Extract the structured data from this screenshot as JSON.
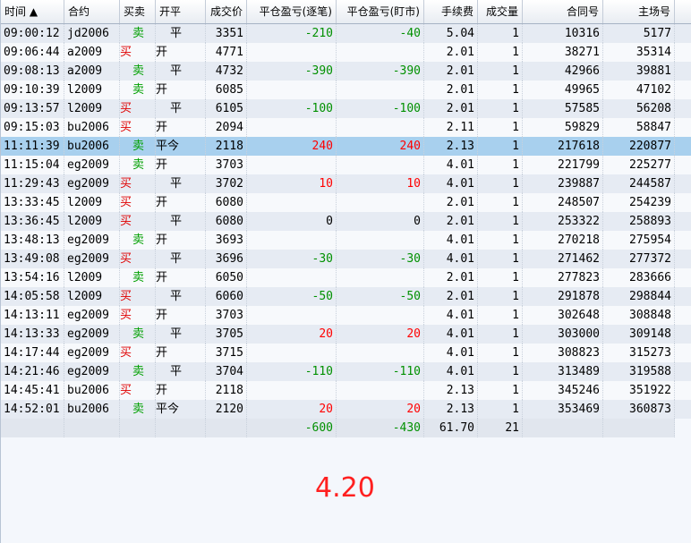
{
  "headers": [
    "时间 ▲",
    "合约",
    "买卖",
    "开平",
    "成交价",
    "平仓盈亏(逐笔)",
    "平仓盈亏(盯市)",
    "手续费",
    "成交量",
    "合同号",
    "主场号"
  ],
  "rows": [
    {
      "time": "09:00:12",
      "contract": "jd2006",
      "bs": "卖",
      "bs_type": "sell",
      "oc": "平",
      "oc_type": "close",
      "price": "3351",
      "pnl1": "-210",
      "pnl1_type": "neg",
      "pnl2": "-40",
      "pnl2_type": "neg",
      "fee": "5.04",
      "qty": "1",
      "order": "10316",
      "match": "5177",
      "style": "alt"
    },
    {
      "time": "09:06:44",
      "contract": "a2009",
      "bs": "买",
      "bs_type": "buy",
      "oc": "开",
      "oc_type": "open",
      "price": "4771",
      "pnl1": "",
      "pnl1_type": "zero",
      "pnl2": "",
      "pnl2_type": "zero",
      "fee": "2.01",
      "qty": "1",
      "order": "38271",
      "match": "35314",
      "style": "plain"
    },
    {
      "time": "09:08:13",
      "contract": "a2009",
      "bs": "卖",
      "bs_type": "sell",
      "oc": "平",
      "oc_type": "close",
      "price": "4732",
      "pnl1": "-390",
      "pnl1_type": "neg",
      "pnl2": "-390",
      "pnl2_type": "neg",
      "fee": "2.01",
      "qty": "1",
      "order": "42966",
      "match": "39881",
      "style": "alt"
    },
    {
      "time": "09:10:39",
      "contract": "l2009",
      "bs": "卖",
      "bs_type": "sell",
      "oc": "开",
      "oc_type": "open",
      "price": "6085",
      "pnl1": "",
      "pnl1_type": "zero",
      "pnl2": "",
      "pnl2_type": "zero",
      "fee": "2.01",
      "qty": "1",
      "order": "49965",
      "match": "47102",
      "style": "plain"
    },
    {
      "time": "09:13:57",
      "contract": "l2009",
      "bs": "买",
      "bs_type": "buy",
      "oc": "平",
      "oc_type": "close",
      "price": "6105",
      "pnl1": "-100",
      "pnl1_type": "neg",
      "pnl2": "-100",
      "pnl2_type": "neg",
      "fee": "2.01",
      "qty": "1",
      "order": "57585",
      "match": "56208",
      "style": "alt"
    },
    {
      "time": "09:15:03",
      "contract": "bu2006",
      "bs": "买",
      "bs_type": "buy",
      "oc": "开",
      "oc_type": "open",
      "price": "2094",
      "pnl1": "",
      "pnl1_type": "zero",
      "pnl2": "",
      "pnl2_type": "zero",
      "fee": "2.11",
      "qty": "1",
      "order": "59829",
      "match": "58847",
      "style": "plain"
    },
    {
      "time": "11:11:39",
      "contract": "bu2006",
      "bs": "卖",
      "bs_type": "sell",
      "oc": "平今",
      "oc_type": "open",
      "price": "2118",
      "pnl1": "240",
      "pnl1_type": "pos",
      "pnl2": "240",
      "pnl2_type": "pos",
      "fee": "2.13",
      "qty": "1",
      "order": "217618",
      "match": "220877",
      "style": "selected"
    },
    {
      "time": "11:15:04",
      "contract": "eg2009",
      "bs": "卖",
      "bs_type": "sell",
      "oc": "开",
      "oc_type": "open",
      "price": "3703",
      "pnl1": "",
      "pnl1_type": "zero",
      "pnl2": "",
      "pnl2_type": "zero",
      "fee": "4.01",
      "qty": "1",
      "order": "221799",
      "match": "225277",
      "style": "plain"
    },
    {
      "time": "11:29:43",
      "contract": "eg2009",
      "bs": "买",
      "bs_type": "buy",
      "oc": "平",
      "oc_type": "close",
      "price": "3702",
      "pnl1": "10",
      "pnl1_type": "pos",
      "pnl2": "10",
      "pnl2_type": "pos",
      "fee": "4.01",
      "qty": "1",
      "order": "239887",
      "match": "244587",
      "style": "alt"
    },
    {
      "time": "13:33:45",
      "contract": "l2009",
      "bs": "买",
      "bs_type": "buy",
      "oc": "开",
      "oc_type": "open",
      "price": "6080",
      "pnl1": "",
      "pnl1_type": "zero",
      "pnl2": "",
      "pnl2_type": "zero",
      "fee": "2.01",
      "qty": "1",
      "order": "248507",
      "match": "254239",
      "style": "plain"
    },
    {
      "time": "13:36:45",
      "contract": "l2009",
      "bs": "买",
      "bs_type": "buy",
      "oc": "平",
      "oc_type": "close",
      "price": "6080",
      "pnl1": "0",
      "pnl1_type": "zero",
      "pnl2": "0",
      "pnl2_type": "zero",
      "fee": "2.01",
      "qty": "1",
      "order": "253322",
      "match": "258893",
      "style": "alt"
    },
    {
      "time": "13:48:13",
      "contract": "eg2009",
      "bs": "卖",
      "bs_type": "sell",
      "oc": "开",
      "oc_type": "open",
      "price": "3693",
      "pnl1": "",
      "pnl1_type": "zero",
      "pnl2": "",
      "pnl2_type": "zero",
      "fee": "4.01",
      "qty": "1",
      "order": "270218",
      "match": "275954",
      "style": "plain"
    },
    {
      "time": "13:49:08",
      "contract": "eg2009",
      "bs": "买",
      "bs_type": "buy",
      "oc": "平",
      "oc_type": "close",
      "price": "3696",
      "pnl1": "-30",
      "pnl1_type": "neg",
      "pnl2": "-30",
      "pnl2_type": "neg",
      "fee": "4.01",
      "qty": "1",
      "order": "271462",
      "match": "277372",
      "style": "alt"
    },
    {
      "time": "13:54:16",
      "contract": "l2009",
      "bs": "卖",
      "bs_type": "sell",
      "oc": "开",
      "oc_type": "open",
      "price": "6050",
      "pnl1": "",
      "pnl1_type": "zero",
      "pnl2": "",
      "pnl2_type": "zero",
      "fee": "2.01",
      "qty": "1",
      "order": "277823",
      "match": "283666",
      "style": "plain"
    },
    {
      "time": "14:05:58",
      "contract": "l2009",
      "bs": "买",
      "bs_type": "buy",
      "oc": "平",
      "oc_type": "close",
      "price": "6060",
      "pnl1": "-50",
      "pnl1_type": "neg",
      "pnl2": "-50",
      "pnl2_type": "neg",
      "fee": "2.01",
      "qty": "1",
      "order": "291878",
      "match": "298844",
      "style": "alt"
    },
    {
      "time": "14:13:11",
      "contract": "eg2009",
      "bs": "买",
      "bs_type": "buy",
      "oc": "开",
      "oc_type": "open",
      "price": "3703",
      "pnl1": "",
      "pnl1_type": "zero",
      "pnl2": "",
      "pnl2_type": "zero",
      "fee": "4.01",
      "qty": "1",
      "order": "302648",
      "match": "308848",
      "style": "plain"
    },
    {
      "time": "14:13:33",
      "contract": "eg2009",
      "bs": "卖",
      "bs_type": "sell",
      "oc": "平",
      "oc_type": "close",
      "price": "3705",
      "pnl1": "20",
      "pnl1_type": "pos",
      "pnl2": "20",
      "pnl2_type": "pos",
      "fee": "4.01",
      "qty": "1",
      "order": "303000",
      "match": "309148",
      "style": "alt"
    },
    {
      "time": "14:17:44",
      "contract": "eg2009",
      "bs": "买",
      "bs_type": "buy",
      "oc": "开",
      "oc_type": "open",
      "price": "3715",
      "pnl1": "",
      "pnl1_type": "zero",
      "pnl2": "",
      "pnl2_type": "zero",
      "fee": "4.01",
      "qty": "1",
      "order": "308823",
      "match": "315273",
      "style": "plain"
    },
    {
      "time": "14:21:46",
      "contract": "eg2009",
      "bs": "卖",
      "bs_type": "sell",
      "oc": "平",
      "oc_type": "close",
      "price": "3704",
      "pnl1": "-110",
      "pnl1_type": "neg",
      "pnl2": "-110",
      "pnl2_type": "neg",
      "fee": "4.01",
      "qty": "1",
      "order": "313489",
      "match": "319588",
      "style": "alt"
    },
    {
      "time": "14:45:41",
      "contract": "bu2006",
      "bs": "买",
      "bs_type": "buy",
      "oc": "开",
      "oc_type": "open",
      "price": "2118",
      "pnl1": "",
      "pnl1_type": "zero",
      "pnl2": "",
      "pnl2_type": "zero",
      "fee": "2.13",
      "qty": "1",
      "order": "345246",
      "match": "351922",
      "style": "plain"
    },
    {
      "time": "14:52:01",
      "contract": "bu2006",
      "bs": "卖",
      "bs_type": "sell",
      "oc": "平今",
      "oc_type": "open",
      "price": "2120",
      "pnl1": "20",
      "pnl1_type": "pos",
      "pnl2": "20",
      "pnl2_type": "pos",
      "fee": "2.13",
      "qty": "1",
      "order": "353469",
      "match": "360873",
      "style": "alt"
    }
  ],
  "totals": {
    "pnl1": "-600",
    "pnl2": "-430",
    "fee": "61.70",
    "qty": "21"
  },
  "overlay_value": "4.20",
  "colors": {
    "buy": "#e00000",
    "sell": "#00a000",
    "profit": "#ff0000",
    "loss": "#009000",
    "selected_row": "#a8d0ee",
    "overlay": "#ff2020"
  }
}
